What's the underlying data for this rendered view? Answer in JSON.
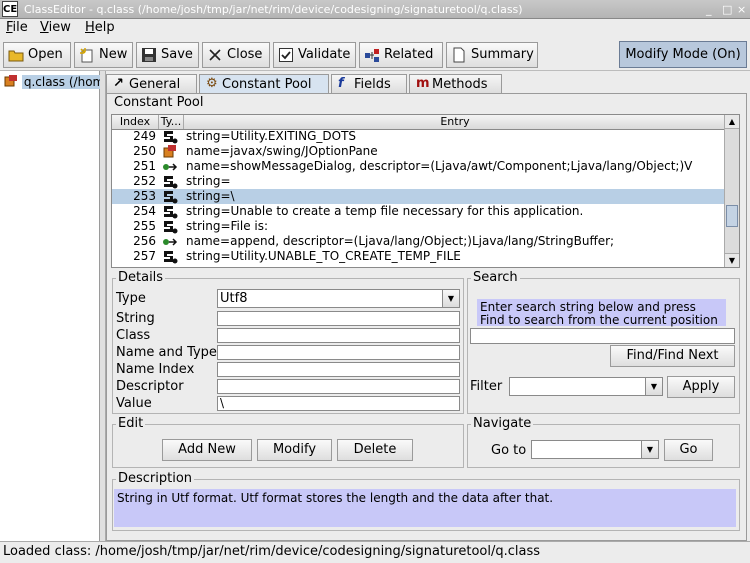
{
  "window": {
    "app_icon": "CE",
    "title": "ClassEditor - q.class (/home/josh/tmp/jar/net/rim/device/codesigning/signaturetool/q.class)",
    "controls": [
      "_",
      "□",
      "×"
    ]
  },
  "menu": [
    {
      "label": "File",
      "mnemonic": "F"
    },
    {
      "label": "View",
      "mnemonic": "V"
    },
    {
      "label": "Help",
      "mnemonic": "H"
    }
  ],
  "toolbar": {
    "open": "Open",
    "new": "New",
    "save": "Save",
    "close": "Close",
    "validate": "Validate",
    "related": "Related",
    "summary": "Summary",
    "mode": "Modify Mode (On)"
  },
  "tree": {
    "item": "q.class (/hom"
  },
  "tabs": [
    {
      "label": "General",
      "icon": "arrow-icon"
    },
    {
      "label": "Constant Pool",
      "icon": "pool-icon"
    },
    {
      "label": "Fields",
      "icon": "f-icon"
    },
    {
      "label": "Methods",
      "icon": "m-icon"
    }
  ],
  "constant_pool": {
    "title": "Constant Pool",
    "columns": [
      "Index",
      "Ty...",
      "Entry"
    ],
    "rows": [
      {
        "index": "249",
        "type": "string-icon",
        "entry": "string=Utility.EXITING_DOTS"
      },
      {
        "index": "250",
        "type": "class-icon",
        "entry": "name=javax/swing/JOptionPane"
      },
      {
        "index": "251",
        "type": "method-ref-icon",
        "entry": "name=showMessageDialog, descriptor=(Ljava/awt/Component;Ljava/lang/Object;)V"
      },
      {
        "index": "252",
        "type": "string-icon",
        "entry": "string="
      },
      {
        "index": "253",
        "type": "string-icon",
        "entry": "string=\\"
      },
      {
        "index": "254",
        "type": "string-icon",
        "entry": "string=Unable to create a temp file necessary for this application."
      },
      {
        "index": "255",
        "type": "string-icon",
        "entry": "string=File is:"
      },
      {
        "index": "256",
        "type": "method-ref-icon",
        "entry": "name=append, descriptor=(Ljava/lang/Object;)Ljava/lang/StringBuffer;"
      },
      {
        "index": "257",
        "type": "string-icon",
        "entry": "string=Utility.UNABLE_TO_CREATE_TEMP_FILE"
      }
    ],
    "selected_index": "253"
  },
  "details": {
    "title": "Details",
    "type_label": "Type",
    "type_value": "Utf8",
    "string_label": "String",
    "string_value": "",
    "class_label": "Class",
    "class_value": "",
    "name_and_type_label": "Name and Type",
    "name_and_type_value": "",
    "name_index_label": "Name Index",
    "name_index_value": "",
    "descriptor_label": "Descriptor",
    "descriptor_value": "",
    "value_label": "Value",
    "value_value": "\\"
  },
  "search": {
    "title": "Search",
    "hint": "Enter search string below and press Find to search from the current position",
    "input_value": "",
    "find_button": "Find/Find Next",
    "filter_label": "Filter",
    "filter_value": "",
    "apply_button": "Apply"
  },
  "edit": {
    "title": "Edit",
    "add_new": "Add New",
    "modify": "Modify",
    "delete": "Delete"
  },
  "navigate": {
    "title": "Navigate",
    "goto_label": "Go to",
    "goto_value": "",
    "go_button": "Go"
  },
  "description": {
    "title": "Description",
    "text": "String in Utf format. Utf format stores the length and the data after that."
  },
  "status": {
    "text": "Loaded class: /home/josh/tmp/jar/net/rim/device/codesigning/signaturetool/q.class"
  },
  "colors": {
    "selection": "#b8cfe5",
    "hint_background": "#c8c8f8",
    "mode_button": "#b8c8dc"
  }
}
